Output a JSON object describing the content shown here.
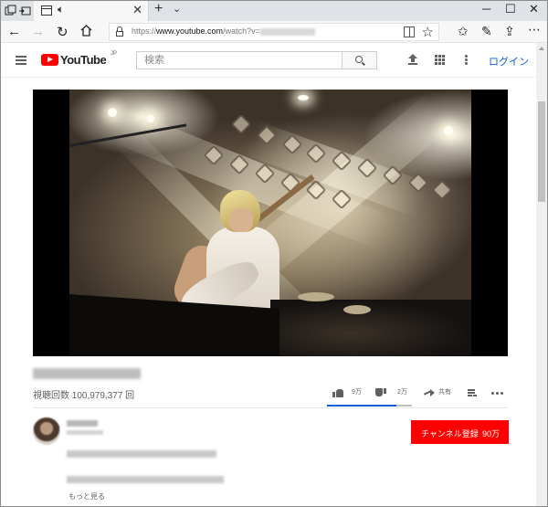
{
  "browser": {
    "url_prefix": "https://",
    "url_host": "www.youtube.com",
    "url_path": "/watch?v="
  },
  "youtube": {
    "logo_text": "YouTube",
    "logo_region": "JP",
    "search_placeholder": "検索",
    "login_label": "ログイン"
  },
  "video": {
    "view_count": "視聴回数 100,979,377 回",
    "likes": "9万",
    "dislikes": "2万",
    "share_label": "共有",
    "like_ratio": 0.82
  },
  "channel": {
    "subscribe_label": "チャンネル登録",
    "subscriber_count": "90万",
    "show_more": "もっと見る"
  },
  "colors": {
    "youtube_red": "#ff0000",
    "link_blue": "#065fd4"
  }
}
